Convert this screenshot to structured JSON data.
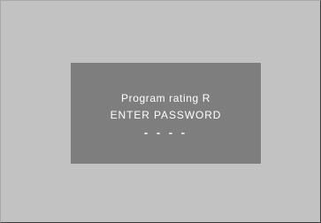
{
  "dialog": {
    "rating_text": "Program rating R",
    "prompt_text": "ENTER PASSWORD",
    "password_mask": "- - - -"
  },
  "colors": {
    "screen_background": "#c2c2c2",
    "dialog_background": "#7e7e7e",
    "text": "#ffffff"
  }
}
